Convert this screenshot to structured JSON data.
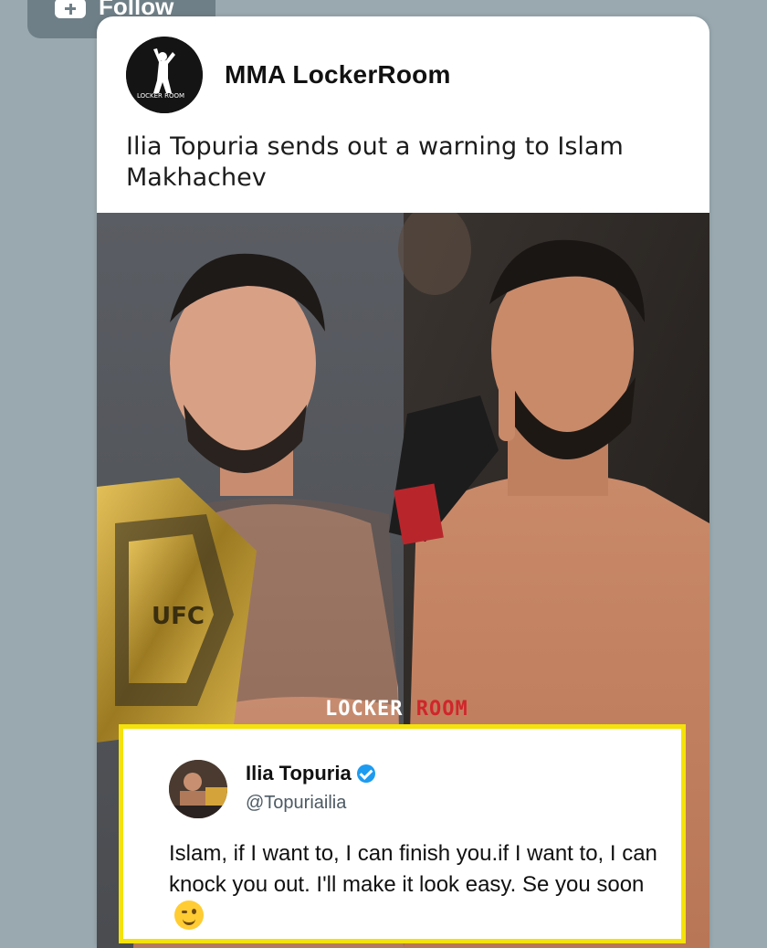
{
  "follow_button": {
    "label": "Follow",
    "icon": "plus-icon"
  },
  "post": {
    "source_name": "MMA LockerRoom",
    "avatar_icon": "lockerroom-logo",
    "avatar_text": "LOCKER ROOM",
    "text": "Ilia Topuria sends out a warning to Islam Makhachev"
  },
  "image": {
    "watermark_locker": "LOCKER",
    "watermark_room": "ROOM",
    "belt_text": "UFC"
  },
  "tweet": {
    "author_name": "Ilia Topuria",
    "handle": "@Topuriailia",
    "verified_icon": "verified-badge-icon",
    "body": "Islam, if I want to, I can finish you.if I want to, I can knock you out. I'll make it look easy. Se you soon",
    "emoji": "wink-emoji-icon",
    "border_color": "#f4e20a"
  }
}
